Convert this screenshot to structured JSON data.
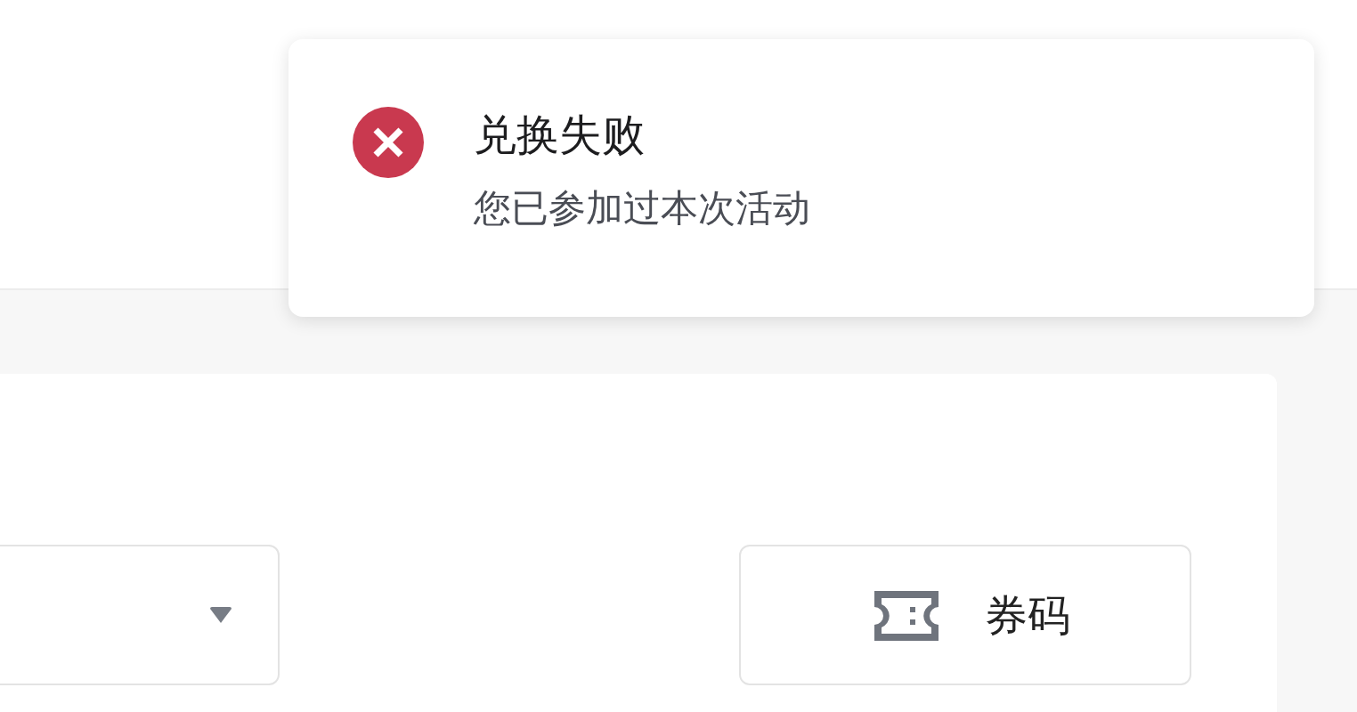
{
  "toast": {
    "kind": "error",
    "title": "兑换失败",
    "message": "您已参加过本次活动"
  },
  "coupon_button": {
    "label": "券码"
  }
}
